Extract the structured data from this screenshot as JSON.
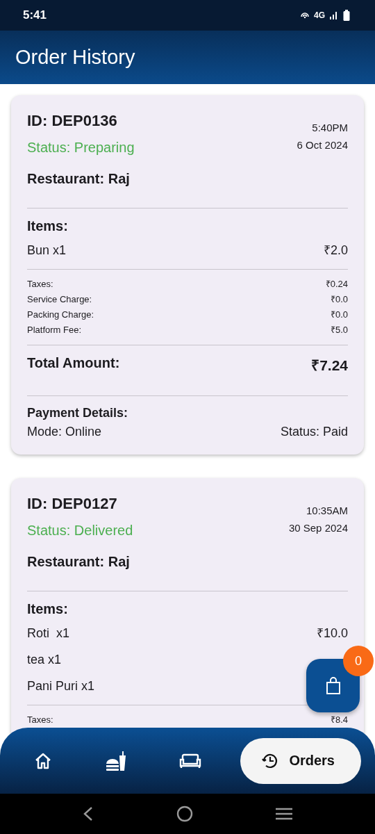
{
  "status_bar": {
    "time": "5:41",
    "network": "4G"
  },
  "app_bar": {
    "title": "Order History"
  },
  "orders": [
    {
      "id": "ID: DEP0136",
      "status": "Status: Preparing",
      "time": "5:40PM",
      "date": "6 Oct 2024",
      "restaurant": "Restaurant: Raj",
      "items_title": "Items:",
      "items": [
        {
          "name": "Bun x1",
          "price": "₹2.0"
        }
      ],
      "charges": [
        {
          "label": "Taxes:",
          "value": "₹0.24"
        },
        {
          "label": "Service Charge:",
          "value": "₹0.0"
        },
        {
          "label": "Packing Charge:",
          "value": "₹0.0"
        },
        {
          "label": "Platform Fee:",
          "value": "₹5.0"
        }
      ],
      "total_label": "Total Amount:",
      "total": "₹7.24",
      "payment_title": "Payment Details:",
      "mode": "Mode: Online",
      "payment_status": "Status: Paid"
    },
    {
      "id": "ID: DEP0127",
      "status": "Status: Delivered",
      "time": "10:35AM",
      "date": "30 Sep 2024",
      "restaurant": "Restaurant: Raj",
      "items_title": "Items:",
      "items": [
        {
          "name": "Roti  x1",
          "price": "₹10.0"
        },
        {
          "name": "tea x1"
        },
        {
          "name": "Pani Puri x1"
        }
      ],
      "charges": [
        {
          "label": "Taxes:",
          "value": "₹8.4"
        }
      ]
    }
  ],
  "cart": {
    "count": "0"
  },
  "nav": [
    {
      "kind": "home",
      "selected": false
    },
    {
      "kind": "food",
      "selected": false
    },
    {
      "kind": "sofa",
      "selected": false
    },
    {
      "kind": "orders",
      "label": "Orders",
      "selected": true
    }
  ]
}
